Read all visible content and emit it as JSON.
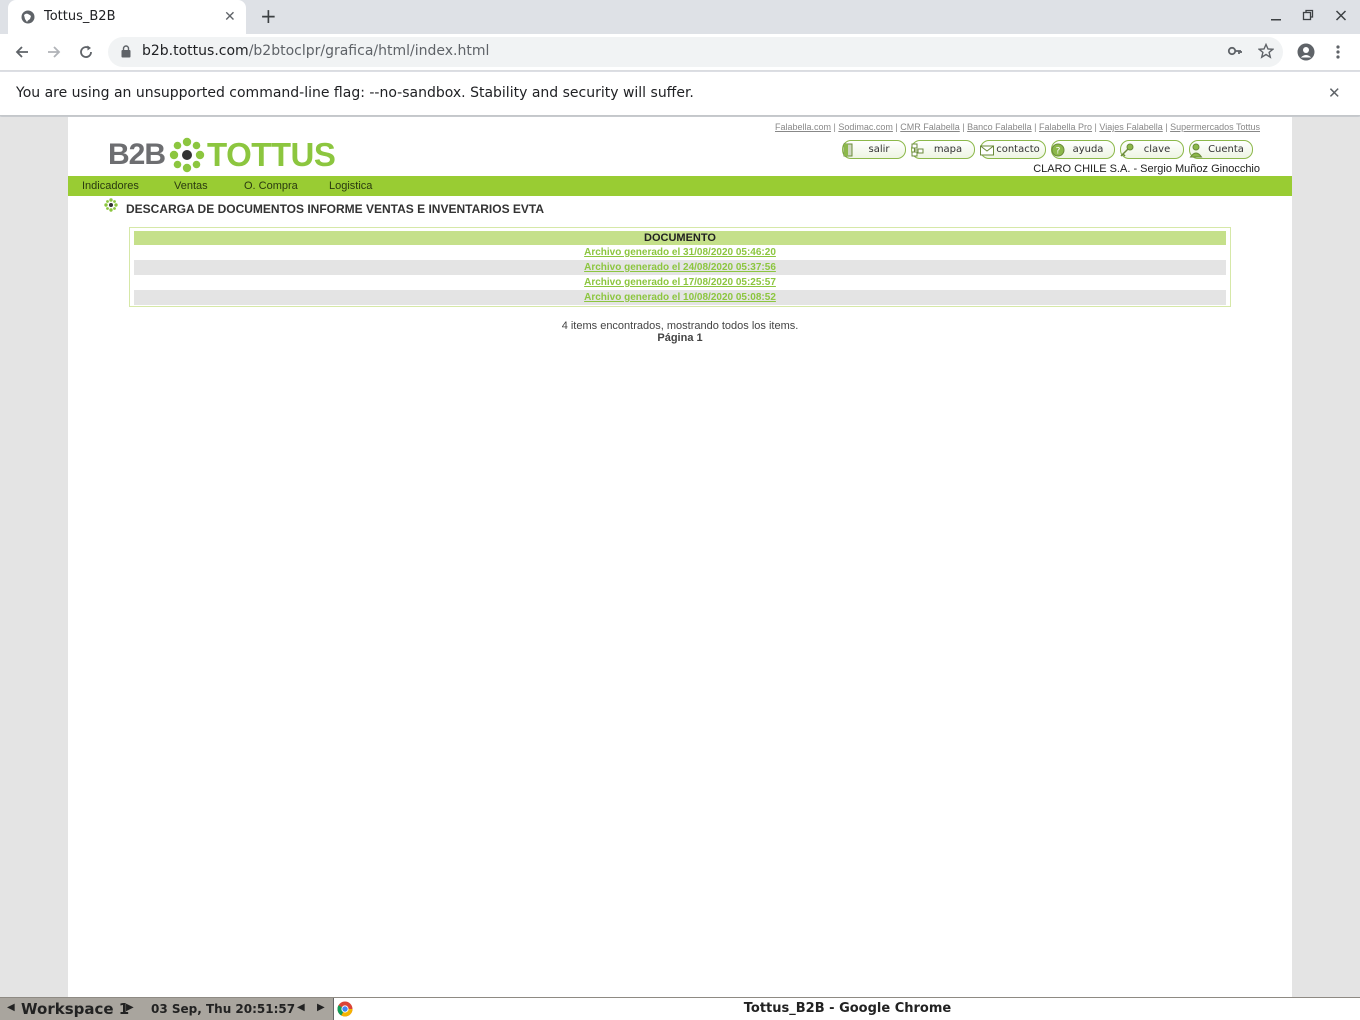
{
  "browser": {
    "tab_title": "Tottus_B2B",
    "new_tab_symbol": "+",
    "url_host": "b2b.tottus.com",
    "url_path": "/b2btoclpr/grafica/html/index.html",
    "infobar_message": "You are using an unsupported command-line flag: --no-sandbox. Stability and security will suffer."
  },
  "site": {
    "top_links": [
      "Falabella.com",
      "Sodimac.com",
      "CMR Falabella",
      "Banco Falabella",
      "Falabella Pro",
      "Viajes Falabella",
      "Supermercados Tottus"
    ],
    "top_links_separator": " | ",
    "logo_b2b": "B2B",
    "logo_brand": "TOTTUS",
    "buttons": {
      "salir": "salir",
      "mapa": "mapa",
      "contacto": "contacto",
      "ayuda": "ayuda",
      "clave": "clave",
      "cuenta": "Cuenta"
    },
    "user_line": "CLARO CHILE S.A. - Sergio Muñoz Ginocchio",
    "menu": {
      "indicadores": "Indicadores",
      "ventas": "Ventas",
      "o_compra": "O. Compra",
      "logistica": "Logistica"
    },
    "page_heading": "DESCARGA DE DOCUMENTOS INFORME VENTAS E INVENTARIOS EVTA",
    "table": {
      "header": "DOCUMENTO",
      "rows": [
        "Archivo generado el 31/08/2020 05:46:20",
        "Archivo generado el 24/08/2020 05:37:56",
        "Archivo generado el 17/08/2020 05:25:57",
        "Archivo generado el 10/08/2020 05:08:52"
      ]
    },
    "items_found": "4 items encontrados, mostrando todos los items.",
    "page_label": "Página 1",
    "colors": {
      "brand_green": "#8cc63f",
      "menu_green": "#99cc33",
      "brand_gray": "#6d6e71"
    }
  },
  "taskbar": {
    "workspace": "Workspace 1",
    "clock": "03 Sep, Thu 20:51:57",
    "window_title": "Tottus_B2B - Google Chrome"
  }
}
